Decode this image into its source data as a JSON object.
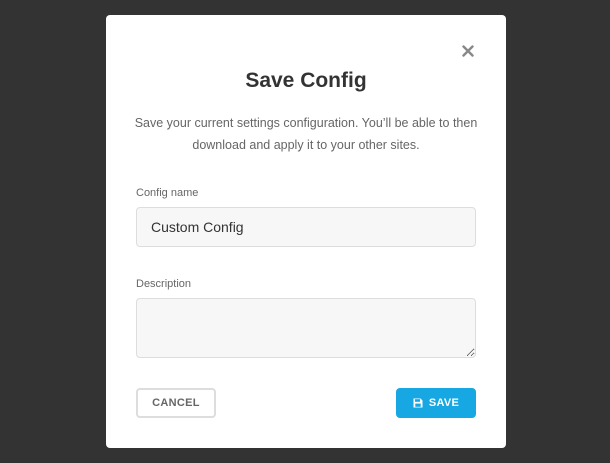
{
  "modal": {
    "title": "Save Config",
    "description": "Save your current settings configuration. You’ll be able to then download and apply it to your other sites.",
    "close_icon": "close-icon"
  },
  "form": {
    "config_name_label": "Config name",
    "config_name_value": "Custom Config",
    "description_label": "Description",
    "description_value": ""
  },
  "actions": {
    "cancel_label": "CANCEL",
    "save_label": "SAVE",
    "save_icon": "floppy-disk-icon"
  },
  "colors": {
    "overlay": "#333333",
    "accent": "#17a8e3"
  }
}
